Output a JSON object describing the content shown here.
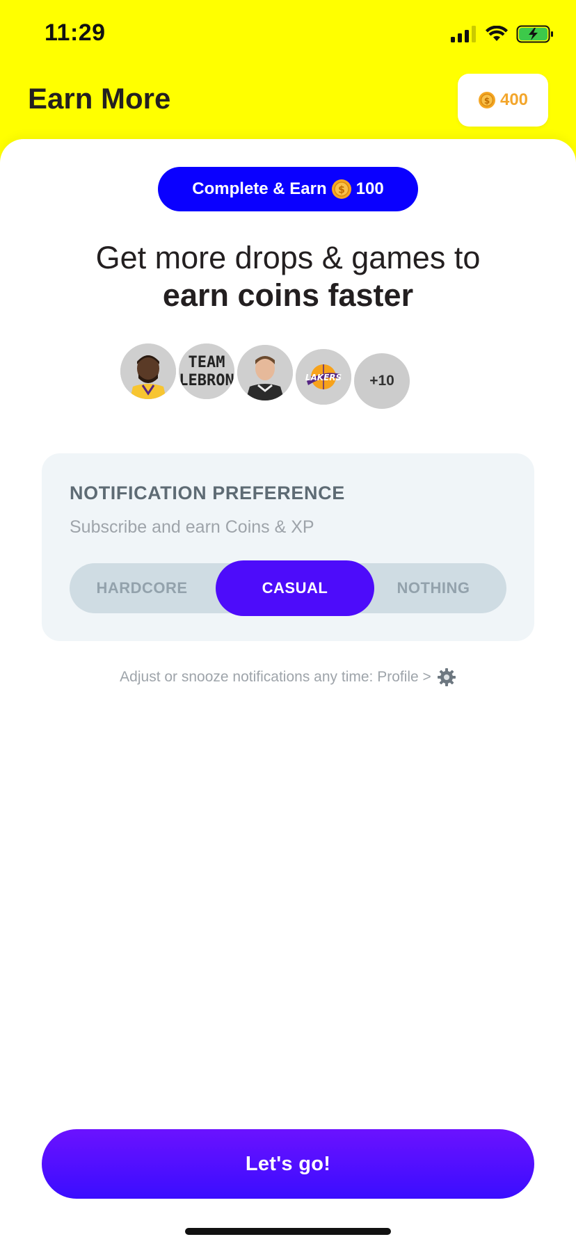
{
  "status_bar": {
    "time": "11:29"
  },
  "header": {
    "title": "Earn More",
    "coins": "400"
  },
  "earn_chip": {
    "prefix": "Complete & Earn",
    "amount": "100"
  },
  "headline": {
    "line1": "Get more drops & games to",
    "line2": "earn coins faster"
  },
  "avatars": {
    "items": [
      "player-avatar",
      "team-lebron-logo",
      "player-avatar",
      "lakers-logo"
    ],
    "more_count": "+10"
  },
  "preference": {
    "title": "NOTIFICATION PREFERENCE",
    "subtitle": "Subscribe and earn Coins & XP",
    "options": [
      "HARDCORE",
      "CASUAL",
      "NOTHING"
    ],
    "selected": "CASUAL"
  },
  "hint": "Adjust or snooze notifications any time: Profile >",
  "cta": "Let's go!",
  "colors": {
    "brand_yellow": "#FFFF00",
    "chip_blue": "#0A00FF",
    "active_purple": "#4D0CFA",
    "coin_gold": "#F3A62C"
  }
}
